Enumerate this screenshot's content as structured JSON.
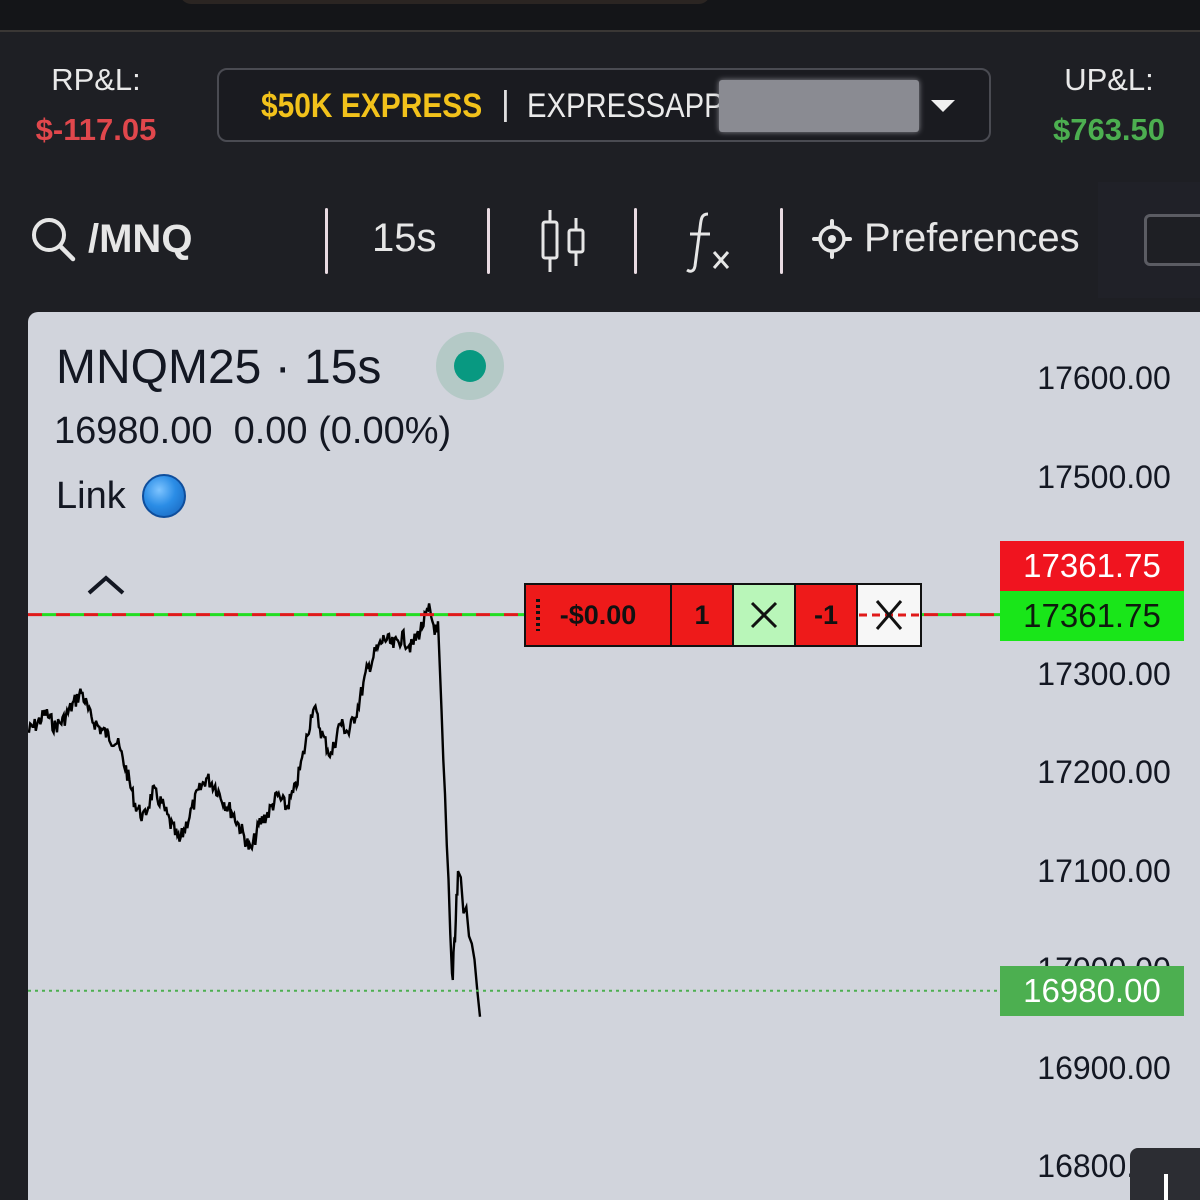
{
  "account_bar": {
    "rpl_label": "RP&L:",
    "rpl_value": "$-117.05",
    "upl_label": "UP&L:",
    "upl_value": "$763.50",
    "account_name": "$50K EXPRESS",
    "separator": "|",
    "account_id": "EXPRESSAPP",
    "colors": {
      "loss": "#e0474c",
      "gain": "#4caf50",
      "account": "#f2c21b"
    }
  },
  "toolbar": {
    "symbol": "/MNQ",
    "interval": "15s",
    "preferences_label": "Preferences",
    "icons": [
      "search-icon",
      "candlestick-icon",
      "fx-icon",
      "gear-icon"
    ]
  },
  "chart": {
    "title": "MNQM25 · 15s",
    "quote": "16980.00  0.00 (0.00%)",
    "link_label": "Link",
    "status_color": "#089981",
    "axis_ticks": [
      "17600.00",
      "17500.00",
      "17300.00",
      "17200.00",
      "17100.00",
      "17000.00",
      "16900.00",
      "16800.00"
    ],
    "tags": {
      "sell_limit": "17361.75",
      "position": "17361.75",
      "last_price": "16980.00"
    },
    "order_widget": {
      "pnl": "-$0.00",
      "quantity": "1",
      "sell_quantity": "-1"
    }
  },
  "chart_data": {
    "type": "line",
    "symbol": "MNQM25",
    "interval": "15s",
    "ylim": [
      16780,
      17640
    ],
    "y_ticks": [
      16800,
      16900,
      17000,
      17100,
      17200,
      17300,
      17500,
      17600
    ],
    "last_price": 16980.0,
    "position_price": 17361.75,
    "series": [
      {
        "name": "MNQM25",
        "values": [
          17243,
          17251,
          17262,
          17248,
          17255,
          17270,
          17284,
          17258,
          17247,
          17239,
          17232,
          17205,
          17170,
          17155,
          17182,
          17170,
          17149,
          17131,
          17155,
          17179,
          17196,
          17188,
          17172,
          17160,
          17142,
          17121,
          17150,
          17161,
          17178,
          17166,
          17185,
          17224,
          17270,
          17240,
          17218,
          17252,
          17242,
          17268,
          17304,
          17324,
          17338,
          17330,
          17339,
          17329,
          17346,
          17366,
          17338,
          16990,
          17100,
          16980
        ]
      }
    ]
  }
}
